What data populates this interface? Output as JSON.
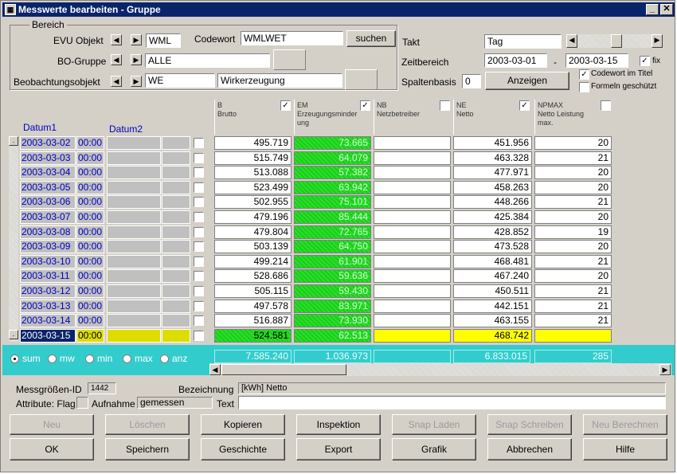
{
  "window": {
    "title": "Messwerte bearbeiten - Gruppe",
    "minimize": "_",
    "close": "✕"
  },
  "bereich": {
    "legend": "Bereich",
    "evu_label": "EVU Objekt",
    "evu_value": "WML",
    "codewort_label": "Codewort",
    "codewort_value": "WMLWET",
    "suchen": "suchen",
    "bo_label": "BO-Gruppe",
    "bo_value": "ALLE",
    "beob_label": "Beobachtungsobjekt",
    "beob_value": "WE",
    "beob_desc": "Wirkerzeugung"
  },
  "right": {
    "takt_label": "Takt",
    "takt_value": "Tag",
    "zeit_label": "Zeitbereich",
    "zeit_from": "2003-03-01",
    "zeit_sep": "-",
    "zeit_to": "2003-03-15",
    "fix_label": "fix",
    "spalten_label": "Spaltenbasis",
    "spalten_value": "0",
    "anzeigen": "Anzeigen",
    "codewort_titel": "Codewort im Titel",
    "formeln": "Formeln geschützt"
  },
  "columns": [
    {
      "code": "B",
      "desc": "Brutto",
      "checked": "✓"
    },
    {
      "code": "EM",
      "desc": "Erzeugungsminder ung",
      "checked": "✓"
    },
    {
      "code": "NB",
      "desc": "Netzbetreiber",
      "checked": ""
    },
    {
      "code": "NE",
      "desc": "Netto",
      "checked": "✓"
    },
    {
      "code": "NPMAX",
      "desc": "Netto Leistung max.",
      "checked": ""
    }
  ],
  "date_headers": {
    "datum1": "Datum1",
    "datum2": "Datum2"
  },
  "rows": [
    {
      "date": "2003-03-02",
      "time": "00:00",
      "b": "495.719",
      "em": "73.665",
      "ne": "451.956",
      "np": "20"
    },
    {
      "date": "2003-03-03",
      "time": "00:00",
      "b": "515.749",
      "em": "64.079",
      "ne": "463.328",
      "np": "21"
    },
    {
      "date": "2003-03-04",
      "time": "00:00",
      "b": "513.088",
      "em": "57.382",
      "ne": "477.971",
      "np": "20"
    },
    {
      "date": "2003-03-05",
      "time": "00:00",
      "b": "523.499",
      "em": "63.942",
      "ne": "458.263",
      "np": "20"
    },
    {
      "date": "2003-03-06",
      "time": "00:00",
      "b": "502.955",
      "em": "75.101",
      "ne": "448.266",
      "np": "21"
    },
    {
      "date": "2003-03-07",
      "time": "00:00",
      "b": "479.196",
      "em": "85.444",
      "ne": "425.384",
      "np": "20"
    },
    {
      "date": "2003-03-08",
      "time": "00:00",
      "b": "479.804",
      "em": "72.765",
      "ne": "428.852",
      "np": "19"
    },
    {
      "date": "2003-03-09",
      "time": "00:00",
      "b": "503.139",
      "em": "64.750",
      "ne": "473.528",
      "np": "20"
    },
    {
      "date": "2003-03-10",
      "time": "00:00",
      "b": "499.214",
      "em": "61.901",
      "ne": "468.481",
      "np": "21"
    },
    {
      "date": "2003-03-11",
      "time": "00:00",
      "b": "528.686",
      "em": "59.636",
      "ne": "467.240",
      "np": "20"
    },
    {
      "date": "2003-03-12",
      "time": "00:00",
      "b": "505.115",
      "em": "59.430",
      "ne": "450.511",
      "np": "21"
    },
    {
      "date": "2003-03-13",
      "time": "00:00",
      "b": "497.578",
      "em": "83.971",
      "ne": "442.151",
      "np": "21"
    },
    {
      "date": "2003-03-14",
      "time": "00:00",
      "b": "516.887",
      "em": "73.930",
      "ne": "463.155",
      "np": "21"
    },
    {
      "date": "2003-03-15",
      "time": "00:00",
      "b": "524.581",
      "em": "62.513",
      "ne": "468.742",
      "np": ""
    }
  ],
  "sums": {
    "b": "7.585.240",
    "em": "1.036.973",
    "nb": "",
    "ne": "6.833.015",
    "np": "285"
  },
  "aggregates": [
    {
      "label": "sum",
      "selected": true
    },
    {
      "label": "mw",
      "selected": false
    },
    {
      "label": "min",
      "selected": false
    },
    {
      "label": "max",
      "selected": false
    },
    {
      "label": "anz",
      "selected": false
    }
  ],
  "info": {
    "id_label": "Messgrößen-ID",
    "id_value": "1442",
    "bez_label": "Bezeichnung",
    "bez_value": "[kWh] Netto",
    "attr_label": "Attribute: Flag",
    "aufnahme_label": "Aufnahme",
    "aufnahme_value": "gemessen",
    "text_label": "Text"
  },
  "buttons_row1": [
    "Neu",
    "Löschen",
    "Kopieren",
    "Inspektion",
    "Snap Laden",
    "Snap Schreiben",
    "Neu Berechnen"
  ],
  "buttons_row2": [
    "OK",
    "Speichern",
    "Geschichte",
    "Export",
    "Grafik",
    "Abbrechen",
    "Hilfe"
  ],
  "colors": {
    "title": "#0a246a",
    "green": "#22d322",
    "yellow": "#ffff00",
    "cyan": "#33cccc"
  }
}
